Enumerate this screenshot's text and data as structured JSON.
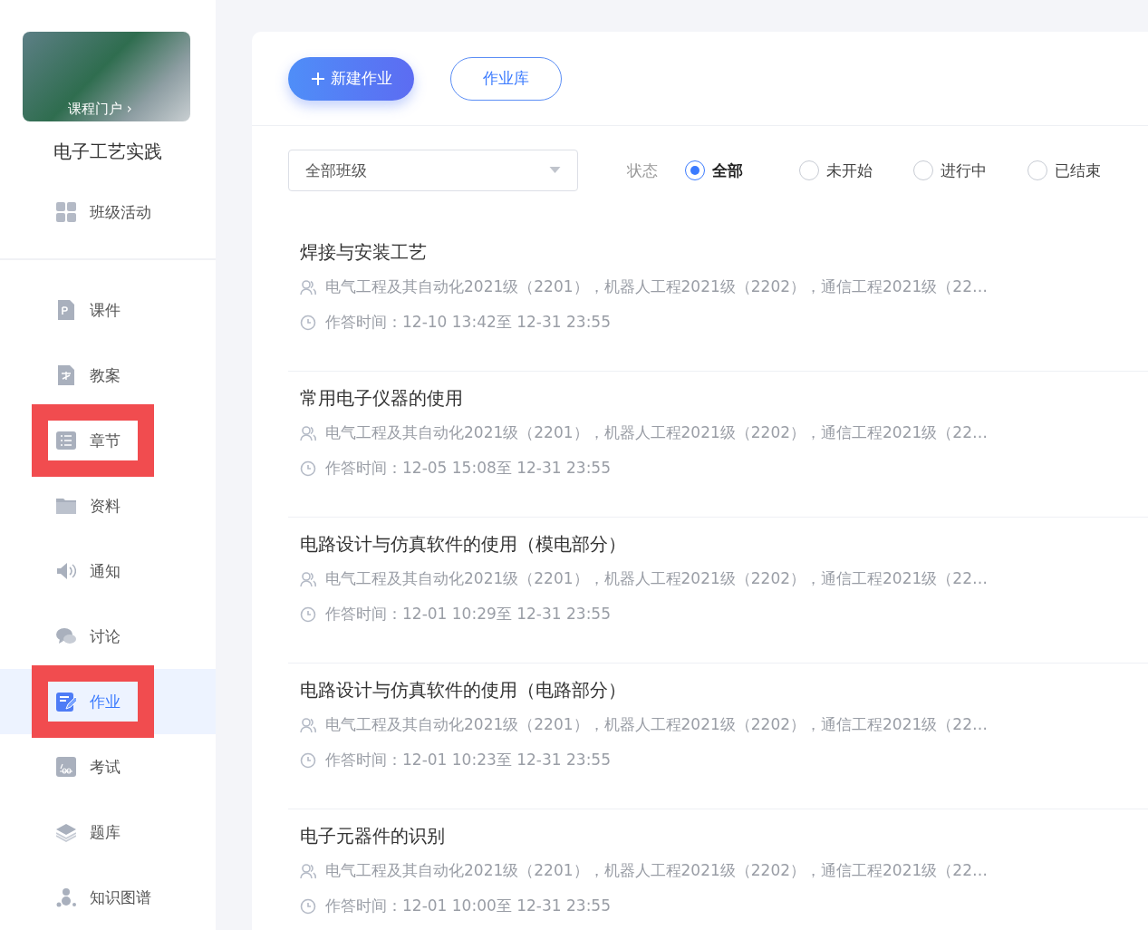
{
  "sidebar": {
    "cover": {
      "link": "课程门户 ›"
    },
    "course_title": "电子工艺实践",
    "top_item": {
      "label": "班级活动"
    },
    "items": [
      {
        "kind": "courseware",
        "label": "课件",
        "selected": false,
        "highlighted": false
      },
      {
        "kind": "lesson-plan",
        "label": "教案",
        "selected": false,
        "highlighted": false
      },
      {
        "kind": "chapter",
        "label": "章节",
        "selected": false,
        "highlighted": true
      },
      {
        "kind": "folder",
        "label": "资料",
        "selected": false,
        "highlighted": false
      },
      {
        "kind": "notice",
        "label": "通知",
        "selected": false,
        "highlighted": false
      },
      {
        "kind": "discussion",
        "label": "讨论",
        "selected": false,
        "highlighted": false
      },
      {
        "kind": "homework",
        "label": "作业",
        "selected": true,
        "highlighted": true
      },
      {
        "kind": "exam",
        "label": "考试",
        "selected": false,
        "highlighted": false
      },
      {
        "kind": "question-bank",
        "label": "题库",
        "selected": false,
        "highlighted": false
      },
      {
        "kind": "knowledge-graph",
        "label": "知识图谱",
        "selected": false,
        "highlighted": false
      }
    ]
  },
  "toolbar": {
    "new_button": "新建作业",
    "library_button": "作业库"
  },
  "filters": {
    "class_select": "全部班级",
    "status_label": "状态",
    "statuses": [
      {
        "label": "全部",
        "selected": true
      },
      {
        "label": "未开始",
        "selected": false
      },
      {
        "label": "进行中",
        "selected": false
      },
      {
        "label": "已结束",
        "selected": false
      }
    ]
  },
  "assignments": [
    {
      "title": "焊接与安装工艺",
      "classes": "电气工程及其自动化2021级（2201），机器人工程2021级（2202），通信工程2021级（22…",
      "time": "作答时间：12-10 13:42至 12-31 23:55"
    },
    {
      "title": "常用电子仪器的使用",
      "classes": "电气工程及其自动化2021级（2201），机器人工程2021级（2202），通信工程2021级（22…",
      "time": "作答时间：12-05 15:08至 12-31 23:55"
    },
    {
      "title": "电路设计与仿真软件的使用（模电部分）",
      "classes": "电气工程及其自动化2021级（2201），机器人工程2021级（2202），通信工程2021级（22…",
      "time": "作答时间：12-01 10:29至 12-31 23:55"
    },
    {
      "title": "电路设计与仿真软件的使用（电路部分）",
      "classes": "电气工程及其自动化2021级（2201），机器人工程2021级（2202），通信工程2021级（22…",
      "time": "作答时间：12-01 10:23至 12-31 23:55"
    },
    {
      "title": "电子元器件的识别",
      "classes": "电气工程及其自动化2021级（2201），机器人工程2021级（2202），通信工程2021级（22…",
      "time": "作答时间：12-01 10:00至 12-31 23:55"
    }
  ]
}
